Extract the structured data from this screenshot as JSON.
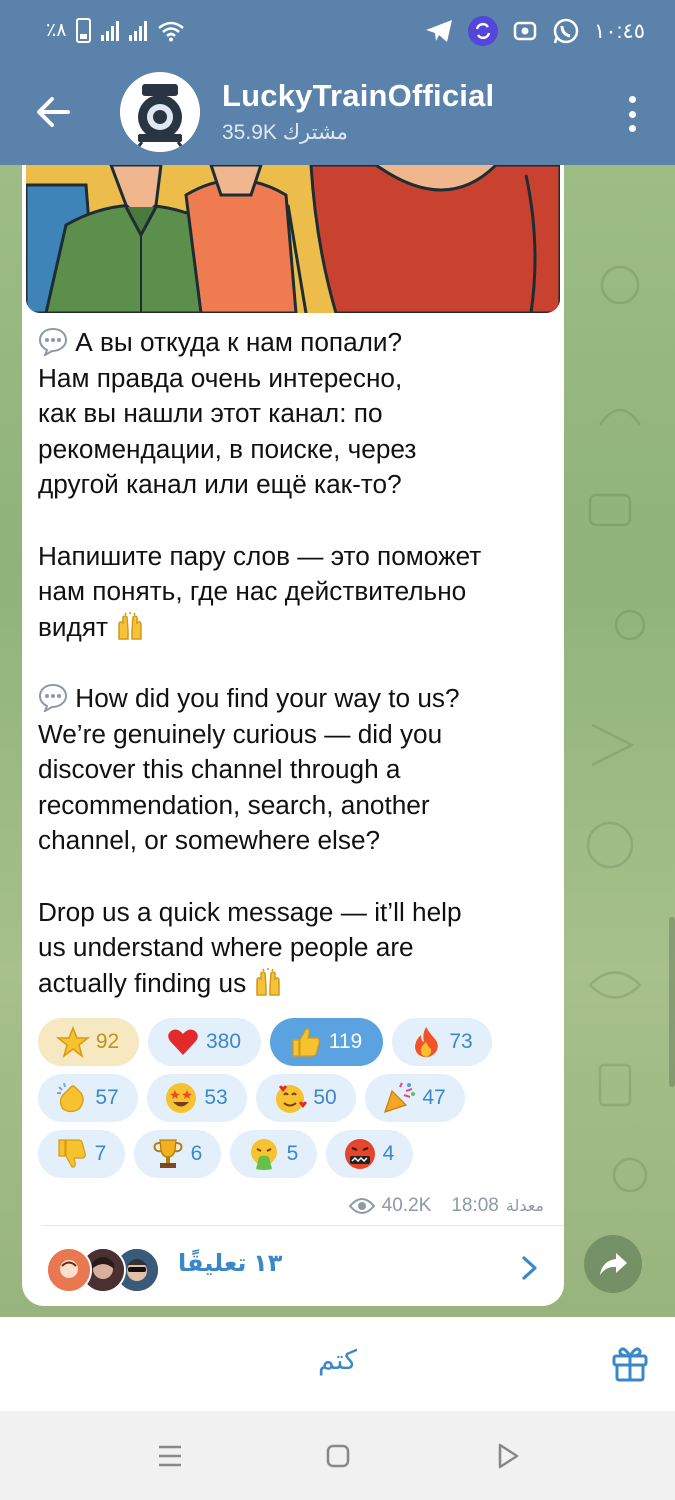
{
  "status_bar": {
    "battery_text": "٪٨",
    "time": "١٠:٤٥",
    "icons": [
      "battery-icon",
      "signal-icon",
      "signal-icon",
      "wifi-icon",
      "telegram-icon",
      "sync-app-icon",
      "record-icon",
      "whatsapp-icon"
    ]
  },
  "header": {
    "title": "LuckyTrainOfficial",
    "subtitle": "35.9K مشترك",
    "accent_color": "#5a82aa"
  },
  "message": {
    "paragraphs_ru": [
      "А вы откуда к нам попали? Нам правда очень интересно, как вы нашли этот канал: по рекомендации, в поиске, через другой канал или ещё как-то?",
      "Напишите пару слов — это поможет нам понять, где нас действительно видят"
    ],
    "paragraphs_en": [
      "How did you find your way to us? We’re genuinely curious — did you discover this channel through a recommendation, search, another channel, or somewhere else?",
      "Drop us a quick message — it’ll help us understand where people are actually finding us"
    ],
    "ru_line1": "А вы откуда к нам попали?",
    "ru_line2": "Нам правда очень интересно,",
    "ru_line3": "как вы нашли этот канал: по",
    "ru_line4": "рекомендации, в поиске, через",
    "ru_line5": "другой канал или ещё как-то?",
    "ru_line6": "Напишите пару слов — это поможет",
    "ru_line7": "нам понять, где нас действительно",
    "ru_line8": "видят",
    "en_line1": "How did you find your way to us?",
    "en_line2": "We’re genuinely curious — did you",
    "en_line3": "discover this channel through a",
    "en_line4": "recommendation, search, another",
    "en_line5": "channel, or somewhere else?",
    "en_line6": "Drop us a quick message — it’ll help",
    "en_line7": "us understand where people are",
    "en_line8": "actually finding us",
    "views": "40.2K",
    "time": "18:08",
    "edited": "معدلة"
  },
  "reactions": [
    {
      "emoji": "star",
      "count": "92"
    },
    {
      "emoji": "red-heart",
      "count": "380"
    },
    {
      "emoji": "thumbs-up",
      "count": "119"
    },
    {
      "emoji": "fire",
      "count": "73"
    },
    {
      "emoji": "clapping-hands",
      "count": "57"
    },
    {
      "emoji": "star-struck",
      "count": "53"
    },
    {
      "emoji": "smiling-face-with-hearts",
      "count": "50"
    },
    {
      "emoji": "party-popper",
      "count": "47"
    },
    {
      "emoji": "thumbs-down",
      "count": "7"
    },
    {
      "emoji": "trophy",
      "count": "6"
    },
    {
      "emoji": "vomiting-face",
      "count": "5"
    },
    {
      "emoji": "cursing-face",
      "count": "4"
    }
  ],
  "comments": {
    "label": "١٣ تعليقًا"
  },
  "bottom": {
    "mute_label": "كتم"
  },
  "colors": {
    "link_blue": "#3a88c8",
    "reaction_bg": "#e3f0fb",
    "reaction_active": "#5aa2e0",
    "reaction_gold_bg": "#f6e8c0",
    "chat_bg": "#9dbd84"
  }
}
